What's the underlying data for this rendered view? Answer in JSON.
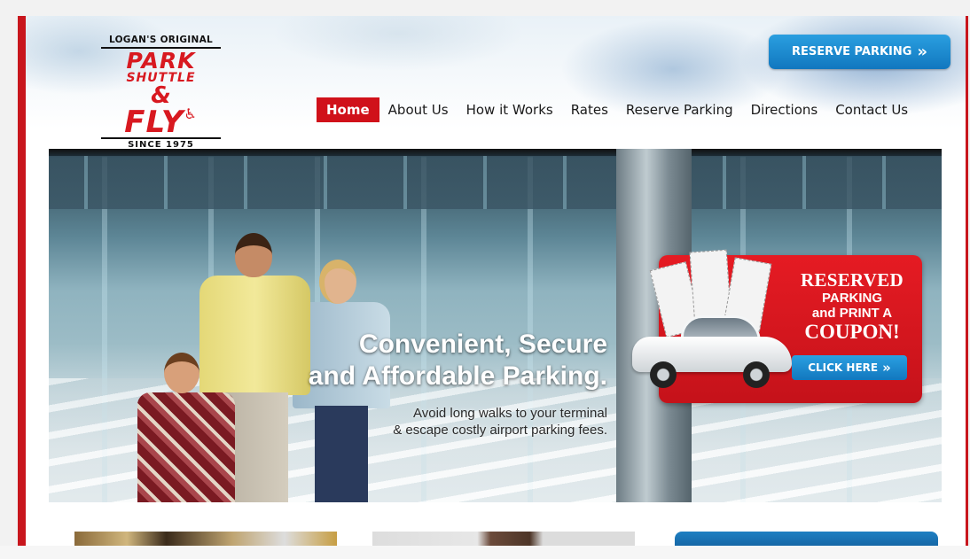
{
  "logo": {
    "top": "LOGAN'S ORIGINAL",
    "line1": "PARK",
    "line2": "SHUTTLE",
    "line3": "&",
    "line4": "FLY",
    "since": "SINCE 1975"
  },
  "header": {
    "reserve_button": "RESERVE PARKING"
  },
  "nav": {
    "items": [
      "Home",
      "About Us",
      "How it Works",
      "Rates",
      "Reserve Parking",
      "Directions",
      "Contact Us"
    ],
    "active": "Home"
  },
  "hero": {
    "headline_1": "Convenient, Secure",
    "headline_2": "and Affordable Parking.",
    "sub_1": "Avoid long walks to your terminal",
    "sub_2": "& escape costly airport parking fees."
  },
  "coupon": {
    "line1": "RESERVED",
    "line2": "PARKING",
    "line3": "and PRINT A",
    "line4": "COUPON!",
    "button": "CLICK HERE"
  },
  "colors": {
    "brand_red": "#d0111a",
    "button_blue": "#1a8bd0"
  },
  "icons": [
    "double-chevron-right-icon",
    "wheelchair-icon"
  ]
}
